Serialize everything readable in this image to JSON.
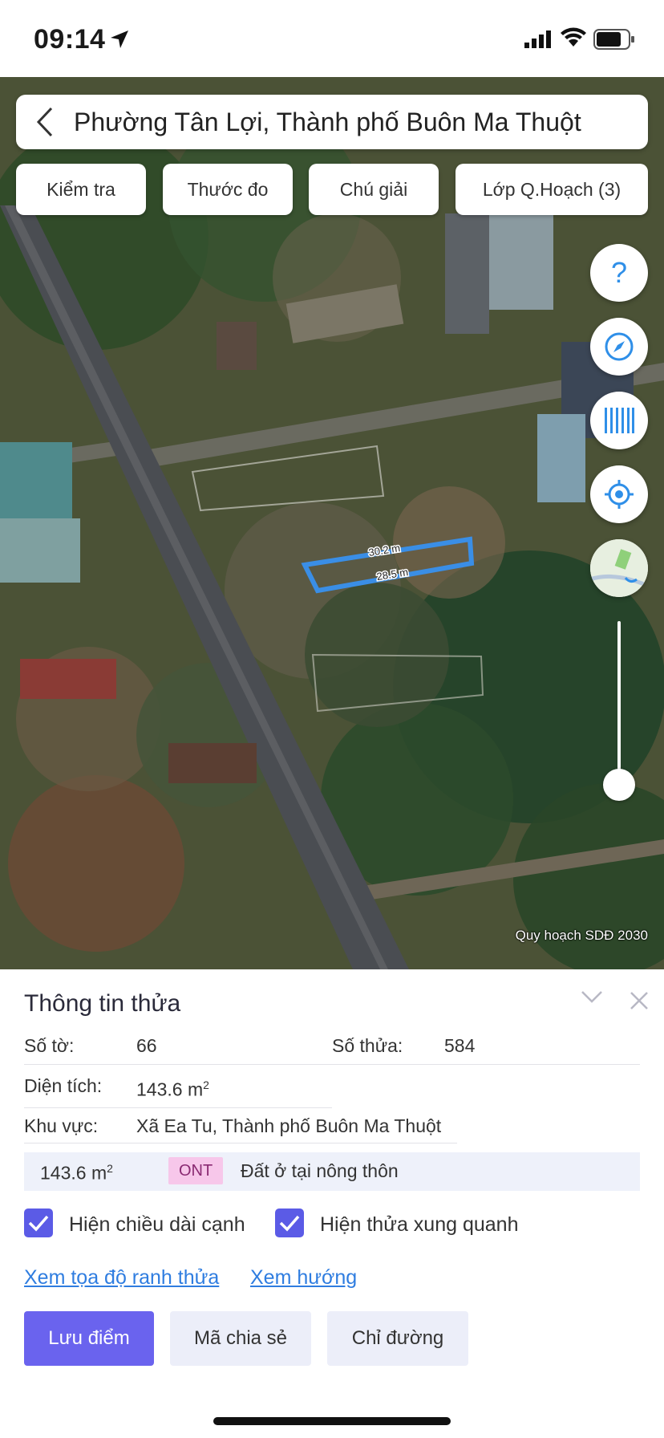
{
  "status_bar": {
    "time": "09:14"
  },
  "search": {
    "title": "Phường Tân Lợi, Thành phố Buôn Ma Thuột"
  },
  "chips": [
    "Kiểm tra",
    "Thước đo",
    "Chú giải",
    "Lớp Q.Hoạch (3)"
  ],
  "map": {
    "edge_labels": [
      "30.2 m",
      "28.5 m"
    ],
    "attribution": "Quy hoạch SDĐ 2030",
    "fab_icons": [
      "help-icon",
      "compass-icon",
      "barcode-icon",
      "locate-icon",
      "map-thumbnail-icon"
    ],
    "accent": "#3a8ee6"
  },
  "panel": {
    "title": "Thông tin thửa",
    "so_to_label": "Số tờ:",
    "so_to_value": "66",
    "so_thua_label": "Số thửa:",
    "so_thua_value": "584",
    "dien_tich_label": "Diện tích:",
    "dien_tich_value": "143.6 m",
    "dien_tich_unit_sup": "2",
    "khu_vuc_label": "Khu vực:",
    "khu_vuc_value": "Xã Ea Tu, Thành phố Buôn Ma Thuột",
    "land_use": {
      "area": "143.6 m",
      "area_sup": "2",
      "code": "ONT",
      "description": "Đất ở tại nông thôn",
      "badge_color": "#f7c7ea"
    },
    "checkboxes": [
      {
        "label": "Hiện chiều dài cạnh",
        "checked": true
      },
      {
        "label": "Hiện thửa xung quanh",
        "checked": true
      }
    ],
    "links": [
      "Xem tọa độ ranh thửa",
      "Xem hướng"
    ],
    "buttons": {
      "save": "Lưu điểm",
      "share": "Mã chia sẻ",
      "directions": "Chỉ đường"
    },
    "primary_color": "#6a63ee"
  }
}
